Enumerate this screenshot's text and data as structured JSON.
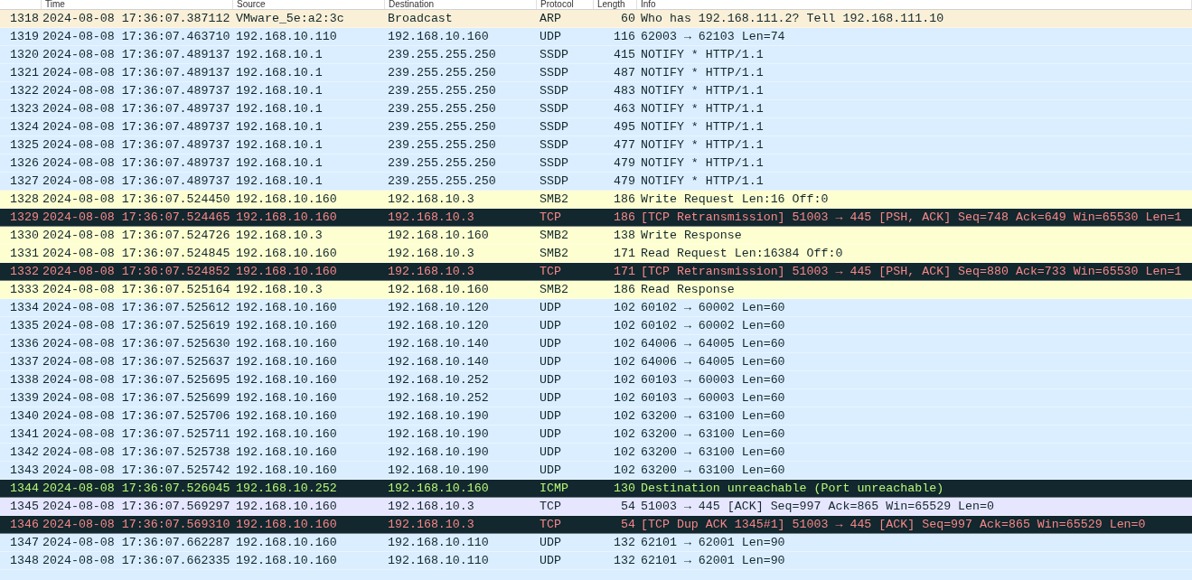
{
  "table": {
    "columns": [
      "Time",
      "Source",
      "Destination",
      "Protocol",
      "Length",
      "Info"
    ],
    "rows": [
      {
        "no": "1318",
        "time": "2024-08-08 17:36:07.387112",
        "source": "VMware_5e:a2:3c",
        "destination": "Broadcast",
        "protocol": "ARP",
        "length": "60",
        "info": "Who has 192.168.111.2? Tell 192.168.111.10",
        "kind": "arp"
      },
      {
        "no": "1319",
        "time": "2024-08-08 17:36:07.463710",
        "source": "192.168.10.110",
        "destination": "192.168.10.160",
        "protocol": "UDP",
        "length": "116",
        "info": "62003 → 62103 Len=74",
        "kind": "udp"
      },
      {
        "no": "1320",
        "time": "2024-08-08 17:36:07.489137",
        "source": "192.168.10.1",
        "destination": "239.255.255.250",
        "protocol": "SSDP",
        "length": "415",
        "info": "NOTIFY * HTTP/1.1",
        "kind": "udp"
      },
      {
        "no": "1321",
        "time": "2024-08-08 17:36:07.489137",
        "source": "192.168.10.1",
        "destination": "239.255.255.250",
        "protocol": "SSDP",
        "length": "487",
        "info": "NOTIFY * HTTP/1.1",
        "kind": "udp"
      },
      {
        "no": "1322",
        "time": "2024-08-08 17:36:07.489737",
        "source": "192.168.10.1",
        "destination": "239.255.255.250",
        "protocol": "SSDP",
        "length": "483",
        "info": "NOTIFY * HTTP/1.1",
        "kind": "udp"
      },
      {
        "no": "1323",
        "time": "2024-08-08 17:36:07.489737",
        "source": "192.168.10.1",
        "destination": "239.255.255.250",
        "protocol": "SSDP",
        "length": "463",
        "info": "NOTIFY * HTTP/1.1",
        "kind": "udp"
      },
      {
        "no": "1324",
        "time": "2024-08-08 17:36:07.489737",
        "source": "192.168.10.1",
        "destination": "239.255.255.250",
        "protocol": "SSDP",
        "length": "495",
        "info": "NOTIFY * HTTP/1.1",
        "kind": "udp"
      },
      {
        "no": "1325",
        "time": "2024-08-08 17:36:07.489737",
        "source": "192.168.10.1",
        "destination": "239.255.255.250",
        "protocol": "SSDP",
        "length": "477",
        "info": "NOTIFY * HTTP/1.1",
        "kind": "udp"
      },
      {
        "no": "1326",
        "time": "2024-08-08 17:36:07.489737",
        "source": "192.168.10.1",
        "destination": "239.255.255.250",
        "protocol": "SSDP",
        "length": "479",
        "info": "NOTIFY * HTTP/1.1",
        "kind": "udp"
      },
      {
        "no": "1327",
        "time": "2024-08-08 17:36:07.489737",
        "source": "192.168.10.1",
        "destination": "239.255.255.250",
        "protocol": "SSDP",
        "length": "479",
        "info": "NOTIFY * HTTP/1.1",
        "kind": "udp"
      },
      {
        "no": "1328",
        "time": "2024-08-08 17:36:07.524450",
        "source": "192.168.10.160",
        "destination": "192.168.10.3",
        "protocol": "SMB2",
        "length": "186",
        "info": "Write Request Len:16 Off:0",
        "kind": "smb"
      },
      {
        "no": "1329",
        "time": "2024-08-08 17:36:07.524465",
        "source": "192.168.10.160",
        "destination": "192.168.10.3",
        "protocol": "TCP",
        "length": "186",
        "info": "[TCP Retransmission] 51003 → 445 [PSH, ACK] Seq=748 Ack=649 Win=65530 Len=1",
        "kind": "bad-tcp"
      },
      {
        "no": "1330",
        "time": "2024-08-08 17:36:07.524726",
        "source": "192.168.10.3",
        "destination": "192.168.10.160",
        "protocol": "SMB2",
        "length": "138",
        "info": "Write Response",
        "kind": "smb"
      },
      {
        "no": "1331",
        "time": "2024-08-08 17:36:07.524845",
        "source": "192.168.10.160",
        "destination": "192.168.10.3",
        "protocol": "SMB2",
        "length": "171",
        "info": "Read Request Len:16384 Off:0",
        "kind": "smb"
      },
      {
        "no": "1332",
        "time": "2024-08-08 17:36:07.524852",
        "source": "192.168.10.160",
        "destination": "192.168.10.3",
        "protocol": "TCP",
        "length": "171",
        "info": "[TCP Retransmission] 51003 → 445 [PSH, ACK] Seq=880 Ack=733 Win=65530 Len=1",
        "kind": "bad-tcp"
      },
      {
        "no": "1333",
        "time": "2024-08-08 17:36:07.525164",
        "source": "192.168.10.3",
        "destination": "192.168.10.160",
        "protocol": "SMB2",
        "length": "186",
        "info": "Read Response",
        "kind": "smb"
      },
      {
        "no": "1334",
        "time": "2024-08-08 17:36:07.525612",
        "source": "192.168.10.160",
        "destination": "192.168.10.120",
        "protocol": "UDP",
        "length": "102",
        "info": "60102 → 60002 Len=60",
        "kind": "udp"
      },
      {
        "no": "1335",
        "time": "2024-08-08 17:36:07.525619",
        "source": "192.168.10.160",
        "destination": "192.168.10.120",
        "protocol": "UDP",
        "length": "102",
        "info": "60102 → 60002 Len=60",
        "kind": "udp"
      },
      {
        "no": "1336",
        "time": "2024-08-08 17:36:07.525630",
        "source": "192.168.10.160",
        "destination": "192.168.10.140",
        "protocol": "UDP",
        "length": "102",
        "info": "64006 → 64005 Len=60",
        "kind": "udp"
      },
      {
        "no": "1337",
        "time": "2024-08-08 17:36:07.525637",
        "source": "192.168.10.160",
        "destination": "192.168.10.140",
        "protocol": "UDP",
        "length": "102",
        "info": "64006 → 64005 Len=60",
        "kind": "udp"
      },
      {
        "no": "1338",
        "time": "2024-08-08 17:36:07.525695",
        "source": "192.168.10.160",
        "destination": "192.168.10.252",
        "protocol": "UDP",
        "length": "102",
        "info": "60103 → 60003 Len=60",
        "kind": "udp"
      },
      {
        "no": "1339",
        "time": "2024-08-08 17:36:07.525699",
        "source": "192.168.10.160",
        "destination": "192.168.10.252",
        "protocol": "UDP",
        "length": "102",
        "info": "60103 → 60003 Len=60",
        "kind": "udp"
      },
      {
        "no": "1340",
        "time": "2024-08-08 17:36:07.525706",
        "source": "192.168.10.160",
        "destination": "192.168.10.190",
        "protocol": "UDP",
        "length": "102",
        "info": "63200 → 63100 Len=60",
        "kind": "udp"
      },
      {
        "no": "1341",
        "time": "2024-08-08 17:36:07.525711",
        "source": "192.168.10.160",
        "destination": "192.168.10.190",
        "protocol": "UDP",
        "length": "102",
        "info": "63200 → 63100 Len=60",
        "kind": "udp"
      },
      {
        "no": "1342",
        "time": "2024-08-08 17:36:07.525738",
        "source": "192.168.10.160",
        "destination": "192.168.10.190",
        "protocol": "UDP",
        "length": "102",
        "info": "63200 → 63100 Len=60",
        "kind": "udp"
      },
      {
        "no": "1343",
        "time": "2024-08-08 17:36:07.525742",
        "source": "192.168.10.160",
        "destination": "192.168.10.190",
        "protocol": "UDP",
        "length": "102",
        "info": "63200 → 63100 Len=60",
        "kind": "udp"
      },
      {
        "no": "1344",
        "time": "2024-08-08 17:36:07.526045",
        "source": "192.168.10.252",
        "destination": "192.168.10.160",
        "protocol": "ICMP",
        "length": "130",
        "info": "Destination unreachable (Port unreachable)",
        "kind": "icmp-error"
      },
      {
        "no": "1345",
        "time": "2024-08-08 17:36:07.569297",
        "source": "192.168.10.160",
        "destination": "192.168.10.3",
        "protocol": "TCP",
        "length": "54",
        "info": "51003 → 445 [ACK] Seq=997 Ack=865 Win=65529 Len=0",
        "kind": "tcp"
      },
      {
        "no": "1346",
        "time": "2024-08-08 17:36:07.569310",
        "source": "192.168.10.160",
        "destination": "192.168.10.3",
        "protocol": "TCP",
        "length": "54",
        "info": "[TCP Dup ACK 1345#1] 51003 → 445 [ACK] Seq=997 Ack=865 Win=65529 Len=0",
        "kind": "bad-tcp"
      },
      {
        "no": "1347",
        "time": "2024-08-08 17:36:07.662287",
        "source": "192.168.10.160",
        "destination": "192.168.10.110",
        "protocol": "UDP",
        "length": "132",
        "info": "62101 → 62001 Len=90",
        "kind": "udp"
      },
      {
        "no": "1348",
        "time": "2024-08-08 17:36:07.662335",
        "source": "192.168.10.160",
        "destination": "192.168.10.110",
        "protocol": "UDP",
        "length": "132",
        "info": "62101 → 62001 Len=90",
        "kind": "udp"
      }
    ]
  }
}
